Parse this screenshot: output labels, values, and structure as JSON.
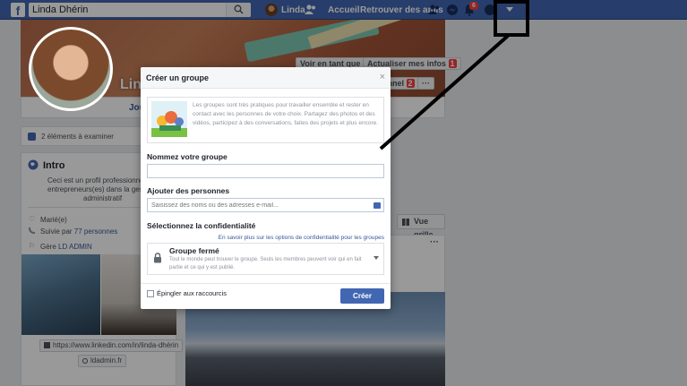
{
  "topbar": {
    "logo": "f",
    "search_value": "Linda Dhérin",
    "user_name": "Linda",
    "nav_home": "Accueil",
    "nav_find_friends": "Retrouver des amis",
    "notifications_count": "6"
  },
  "profile": {
    "name_partial": "Lind",
    "btn_view_as": "Voir en tant que",
    "btn_update": "Actualiser mes infos",
    "btn_update_count": "1",
    "btn_message": "onnel",
    "btn_message_count": "2",
    "btn_more": "···",
    "tab_first": "Jou"
  },
  "left": {
    "review": "2 éléments à examiner",
    "intro_title": "Intro",
    "intro_line1": "Ceci est un profil professionnel. J'a",
    "intro_line2": "entrepreneurs(es) dans la gestion d",
    "intro_line3": "administratif",
    "married": "Marié(e)",
    "followed_prefix": "Suivie par ",
    "followed_link": "77 personnes",
    "manages_prefix": "Gère ",
    "manages_link": "LD ADMIN",
    "linkedin": "https://www.linkedin.com/in/linda-dhérin",
    "website": "ldadmin.fr"
  },
  "right": {
    "view_grid": "Vue grille",
    "more": "···"
  },
  "modal": {
    "title": "Créer un groupe",
    "close": "×",
    "info": "Les groupes sont très pratiques pour travailler ensemble et rester en contact avec les personnes de votre choix. Partagez des photos et des vidéos, participez à des conversations, faites des projets et plus encore.",
    "name_label": "Nommez votre groupe",
    "name_value": "",
    "add_label": "Ajouter des personnes",
    "add_placeholder": "Saisissez des noms ou des adresses e-mail...",
    "privacy_label": "Sélectionnez la confidentialité",
    "learn_more": "En savoir plus sur les options de confidentialité pour les groupes",
    "privacy_name": "Groupe fermé",
    "privacy_desc": "Tout le monde peut trouver le groupe. Seuls les membres peuvent voir qui en fait partie et ce qui y est publié.",
    "pin_label": "Épingler aux raccourcis",
    "create": "Créer"
  },
  "colors": {
    "brand": "#4267b2",
    "badge": "#fa3e3e"
  },
  "icons": [
    "facebook-logo-icon",
    "search-icon",
    "friends-icon",
    "friend-requests-icon",
    "messenger-icon",
    "notifications-icon",
    "help-icon",
    "dropdown-arrow-icon",
    "star-icon",
    "globe-icon",
    "heart-icon",
    "rss-icon",
    "flag-icon",
    "linkedin-icon",
    "link-icon",
    "grid-icon",
    "lock-icon",
    "people-icon"
  ]
}
